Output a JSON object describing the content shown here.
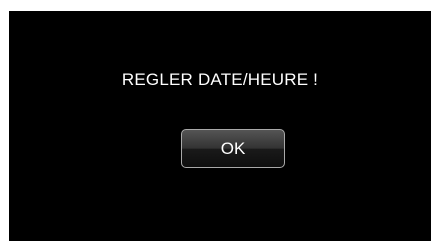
{
  "dialog": {
    "message": "REGLER DATE/HEURE !",
    "ok_label": "OK"
  },
  "colors": {
    "screen_background": "#000000",
    "text": "#ffffff",
    "button_border": "#a9a9a9"
  }
}
